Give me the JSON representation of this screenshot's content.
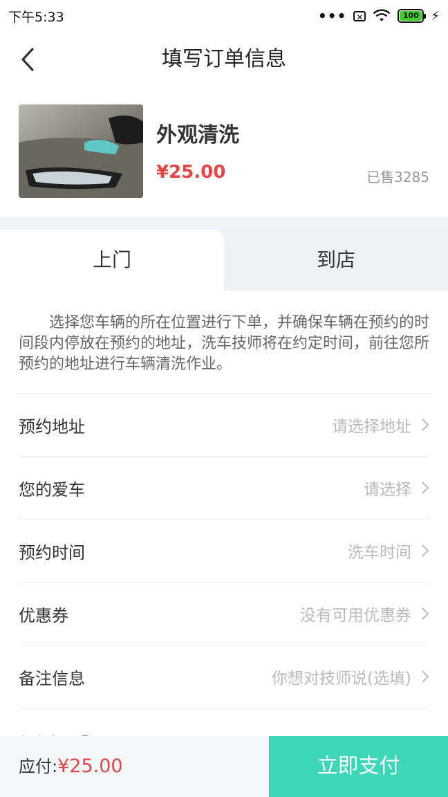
{
  "status_bar": {
    "time": "下午5:33",
    "dots": "•••",
    "sim_label": "✕",
    "battery": "100",
    "charging": "⚡"
  },
  "nav": {
    "title": "填写订单信息",
    "back_icon": "chevron-left-icon"
  },
  "product": {
    "name": "外观清洗",
    "price": "¥25.00",
    "sold": "已售3285"
  },
  "tabs": [
    {
      "label": "上门",
      "active": true
    },
    {
      "label": "到店",
      "active": false
    }
  ],
  "notice": "选择您车辆的所在位置进行下单，并确保车辆在预约的时间段内停放在预约的地址，洗车技师将在约定时间，前往您所预约的地址进行车辆清洗作业。",
  "form_rows": [
    {
      "label": "预约地址",
      "value": "请选择地址"
    },
    {
      "label": "您的爱车",
      "value": "请选择"
    },
    {
      "label": "预约时间",
      "value": "洗车时间"
    },
    {
      "label": "优惠券",
      "value": "没有可用优惠券"
    },
    {
      "label": "备注信息",
      "value": "你想对技师说(选填)"
    }
  ],
  "partial_row": {
    "label": "免责声明"
  },
  "bottom": {
    "pay_label": "应付:",
    "pay_amount": "¥25.00",
    "pay_button": "立即支付"
  },
  "colors": {
    "accent": "#3cd6b9",
    "price": "#e64545"
  }
}
